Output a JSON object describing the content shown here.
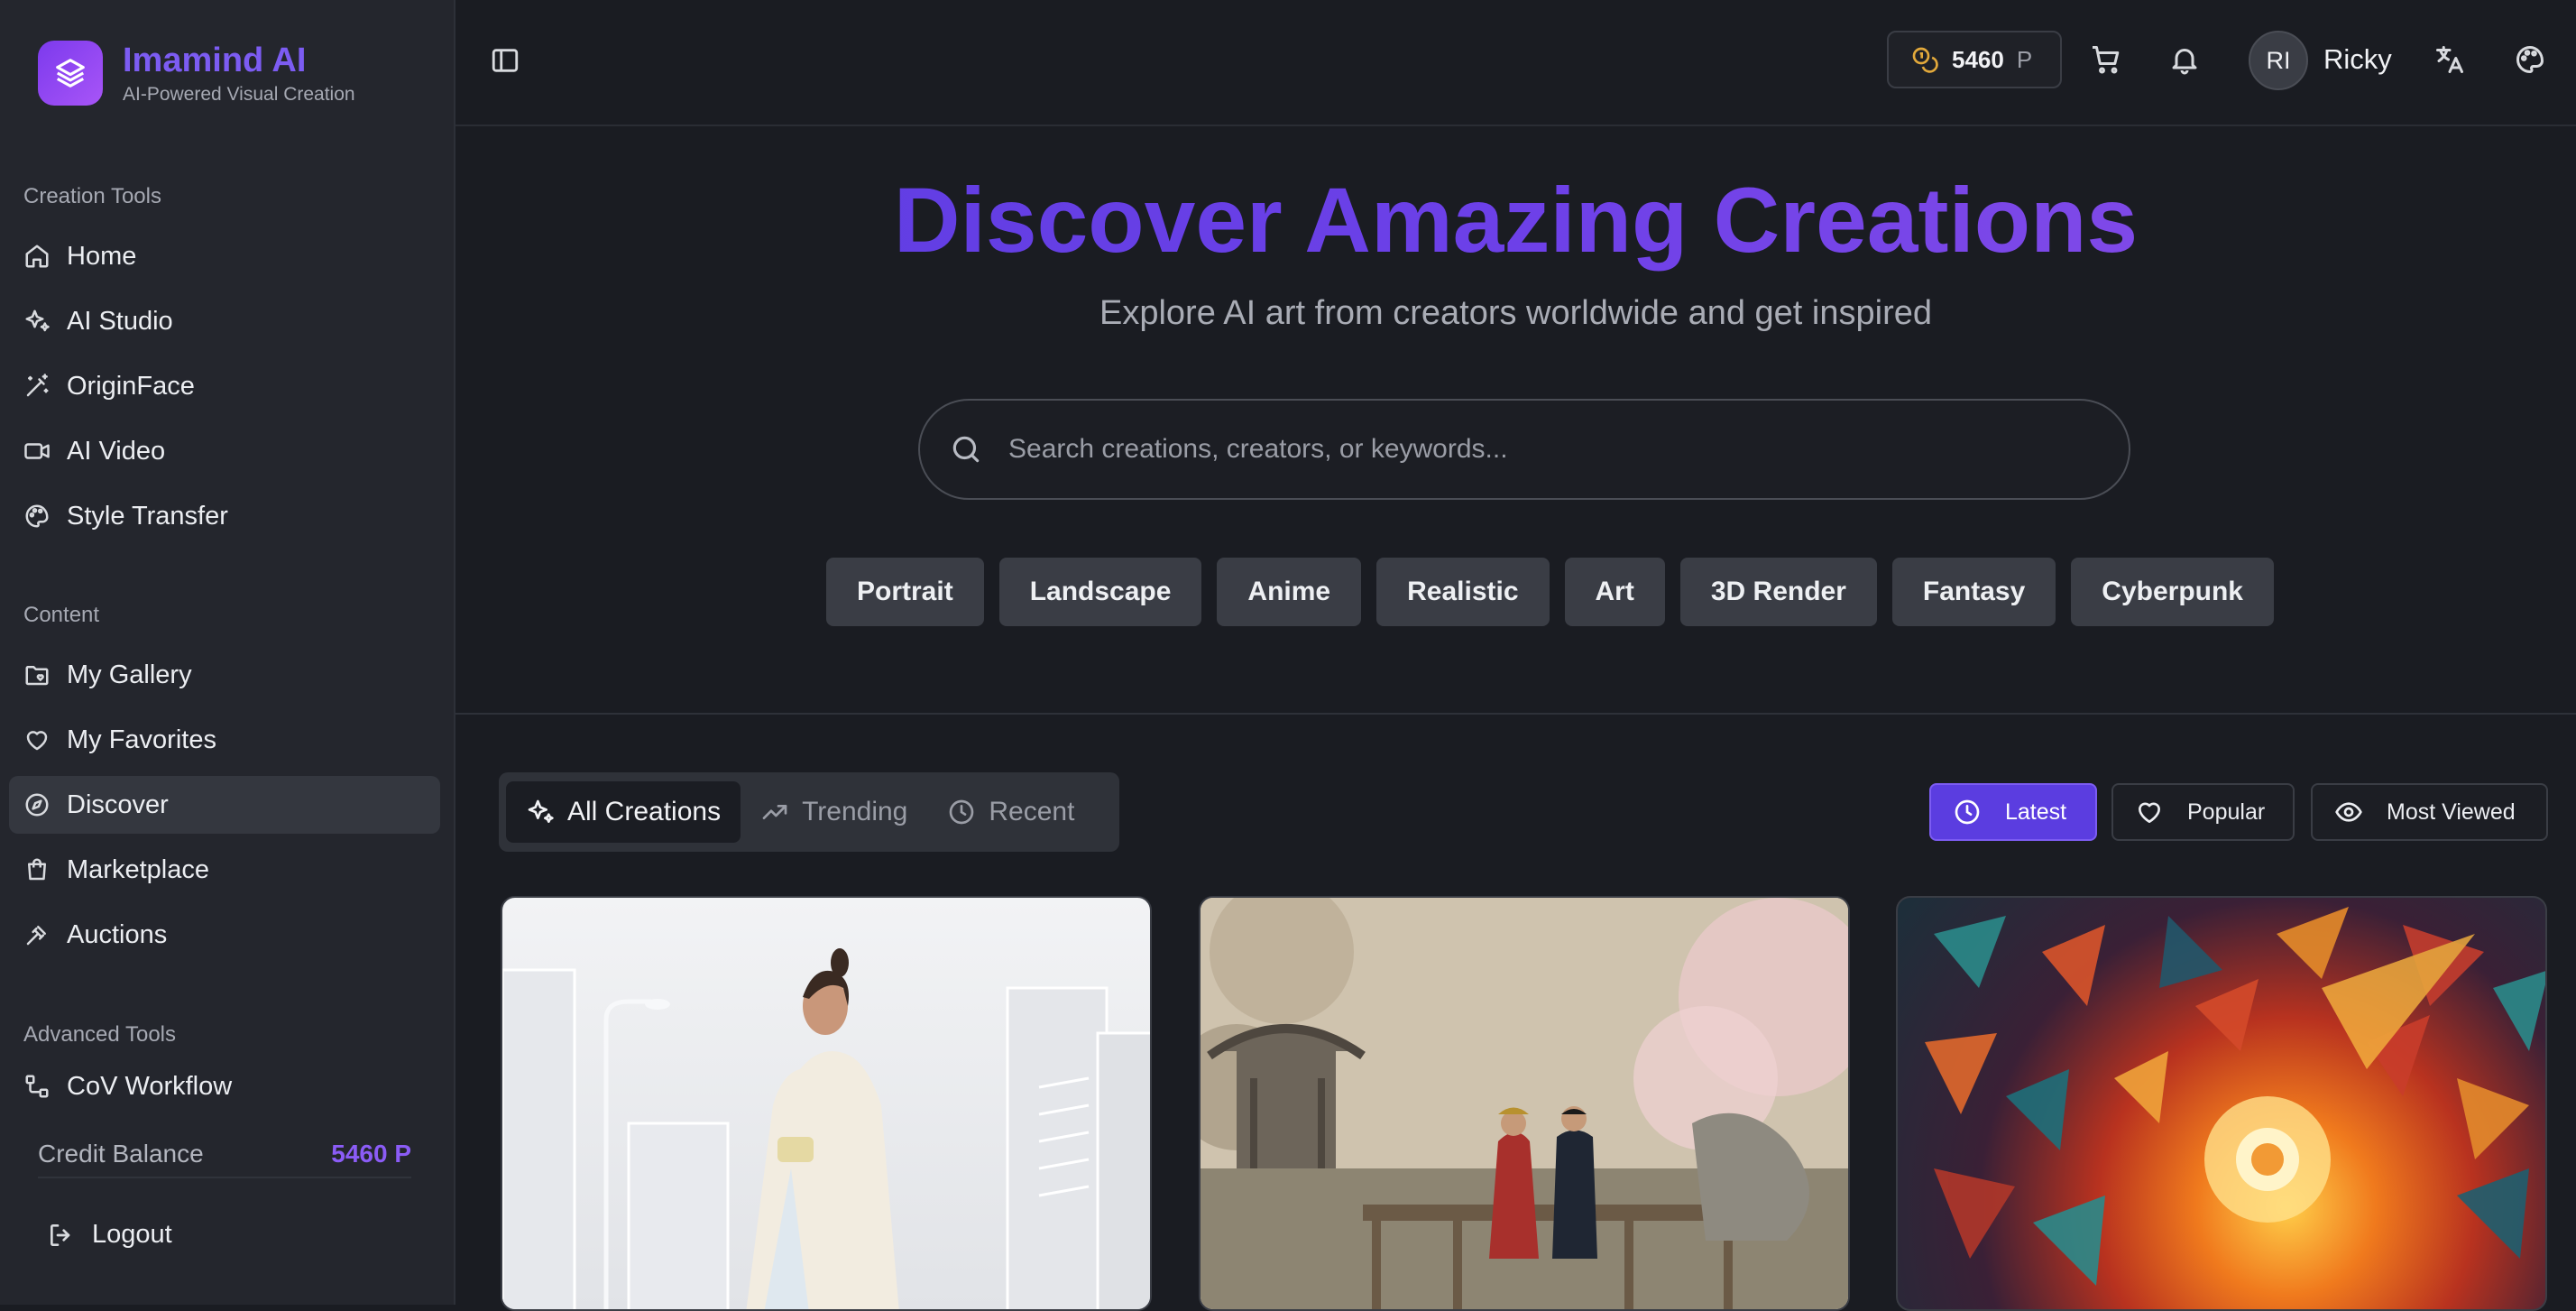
{
  "brand": {
    "name": "Imamind AI",
    "tagline": "AI-Powered Visual Creation"
  },
  "sidebar": {
    "sections": {
      "creation": "Creation Tools",
      "content": "Content",
      "advanced": "Advanced Tools"
    },
    "creation_items": [
      {
        "label": "Home",
        "icon": "home-icon"
      },
      {
        "label": "AI Studio",
        "icon": "sparkles-icon"
      },
      {
        "label": "OriginFace",
        "icon": "wand-icon"
      },
      {
        "label": "AI Video",
        "icon": "video-icon"
      },
      {
        "label": "Style Transfer",
        "icon": "palette-icon"
      }
    ],
    "content_items": [
      {
        "label": "My Gallery",
        "icon": "folder-heart-icon"
      },
      {
        "label": "My Favorites",
        "icon": "heart-icon"
      },
      {
        "label": "Discover",
        "icon": "compass-icon",
        "active": true
      },
      {
        "label": "Marketplace",
        "icon": "shopping-bag-icon"
      },
      {
        "label": "Auctions",
        "icon": "gavel-icon"
      }
    ],
    "advanced_items": [
      {
        "label": "CoV Workflow",
        "icon": "workflow-icon"
      }
    ],
    "credit": {
      "label": "Credit Balance",
      "value": "5460 P"
    },
    "logout": "Logout"
  },
  "topbar": {
    "points": {
      "value": "5460",
      "unit": "P"
    },
    "user": {
      "initials": "RI",
      "name": "Ricky"
    }
  },
  "hero": {
    "title": "Discover Amazing Creations",
    "subtitle": "Explore AI art from creators worldwide and get inspired",
    "search_placeholder": "Search creations, creators, or keywords...",
    "categories": [
      "Portrait",
      "Landscape",
      "Anime",
      "Realistic",
      "Art",
      "3D Render",
      "Fantasy",
      "Cyberpunk"
    ]
  },
  "filters": {
    "tabs": [
      {
        "label": "All Creations",
        "icon": "sparkles-icon",
        "active": true
      },
      {
        "label": "Trending",
        "icon": "trending-up-icon"
      },
      {
        "label": "Recent",
        "icon": "clock-icon"
      }
    ],
    "sort": [
      {
        "label": "Latest",
        "icon": "clock-icon",
        "active": true
      },
      {
        "label": "Popular",
        "icon": "heart-icon"
      },
      {
        "label": "Most Viewed",
        "icon": "eye-icon"
      }
    ]
  },
  "colors": {
    "accent": "#7c5cf2",
    "active_button": "#5b3de0",
    "background": "#1a1c22",
    "sidebar": "#24262d"
  }
}
